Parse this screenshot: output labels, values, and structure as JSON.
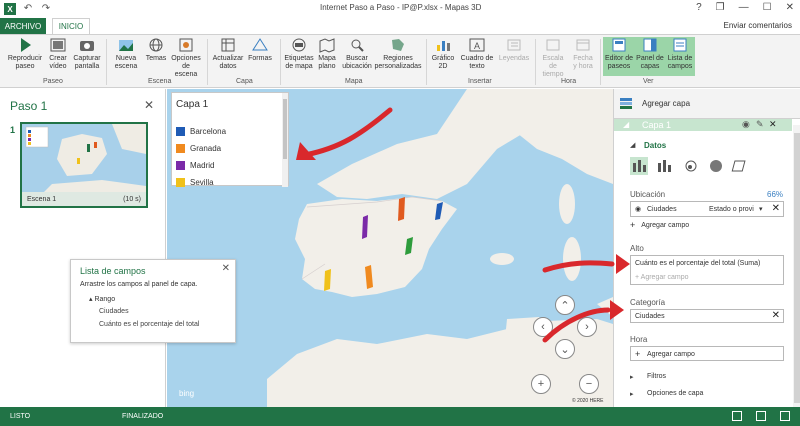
{
  "window": {
    "title": "Internet Paso a Paso - IP@P.xlsx - Mapas 3D",
    "help": "?",
    "restore": "❐",
    "minimize": "—",
    "maximize": "☐",
    "close": "✕"
  },
  "app": {
    "logo": "X",
    "undo": "↶",
    "redo": "↷"
  },
  "tabs": {
    "archivo": "ARCHIVO",
    "inicio": "INICIO",
    "feedback": "Enviar comentarios"
  },
  "ribbon": {
    "groups": {
      "paso": "Paseo",
      "escena": "Escena",
      "capa": "Capa",
      "mapa": "Mapa",
      "insertar": "Insertar",
      "hora": "Hora",
      "ver": "Ver"
    },
    "buttons": {
      "play_1": "Reproducir",
      "play_2": "paseo",
      "video_1": "Crear",
      "video_2": "vídeo",
      "capture_1": "Capturar",
      "capture_2": "pantalla",
      "new_scene_1": "Nueva",
      "new_scene_2": "escena",
      "themes": "Temas",
      "scene_options_1": "Opciones",
      "scene_options_2": "de escena",
      "refresh_1": "Actualizar",
      "refresh_2": "datos",
      "shapes": "Formas",
      "map_labels_1": "Etiquetas",
      "map_labels_2": "de mapa",
      "flat_map_1": "Mapa",
      "flat_map_2": "plano",
      "find_location_1": "Buscar",
      "find_location_2": "ubicación",
      "custom_regions_1": "Regiones",
      "custom_regions_2": "personalizadas",
      "chart2d_1": "Gráfico",
      "chart2d_2": "2D",
      "textbox_1": "Cuadro de",
      "textbox_2": "texto",
      "legends": "Leyendas",
      "time_scale_1": "Escala de",
      "time_scale_2": "tiempo",
      "date_time_1": "Fecha",
      "date_time_2": "y hora",
      "tour_editor_1": "Editor de",
      "tour_editor_2": "paseos",
      "layer_pane_1": "Panel de",
      "layer_pane_2": "capas",
      "field_list_1": "Lista de",
      "field_list_2": "campos"
    }
  },
  "scene_panel": {
    "title": "Paso 1",
    "close": "✕",
    "scene_number": "1",
    "scene_name": "Escena 1",
    "scene_duration": "(10 s)"
  },
  "legend": {
    "title": "Capa 1",
    "items": [
      {
        "label": "Barcelona",
        "color": "#1f5bb5"
      },
      {
        "label": "Granada",
        "color": "#f08a1f"
      },
      {
        "label": "Madrid",
        "color": "#7b2aa8"
      },
      {
        "label": "Sevilla",
        "color": "#f0c11a"
      }
    ]
  },
  "field_list": {
    "title": "Lista de campos",
    "close": "✕",
    "description": "Arrastre los campos al panel de capa.",
    "table": "Rango",
    "fields": [
      "Ciudades",
      "Cuánto es el porcentaje del total"
    ]
  },
  "map": {
    "bing": "bing",
    "copyright": "© 2020 HERE"
  },
  "layer_pane": {
    "add_layer": "Agregar capa",
    "layer_name": "Capa 1",
    "data_section": "Datos",
    "location_label": "Ubicación",
    "location_percent": "66%",
    "location_field": "Ciudades",
    "location_type": "Estado o provi",
    "add_field": "Agregar campo",
    "height_label": "Alto",
    "height_field": "Cuánto es el porcentaje del total (Suma)",
    "category_label": "Categoría",
    "category_field": "Ciudades",
    "time_label": "Hora",
    "filters": "Filtros",
    "layer_options": "Opciones de capa"
  },
  "status": {
    "ready": "LISTO",
    "finished": "FINALIZADO"
  },
  "colors": {
    "excel_green": "#217346",
    "accent_red": "#d9282c",
    "ocean": "#a9d3ec",
    "land": "#f2efe9"
  }
}
